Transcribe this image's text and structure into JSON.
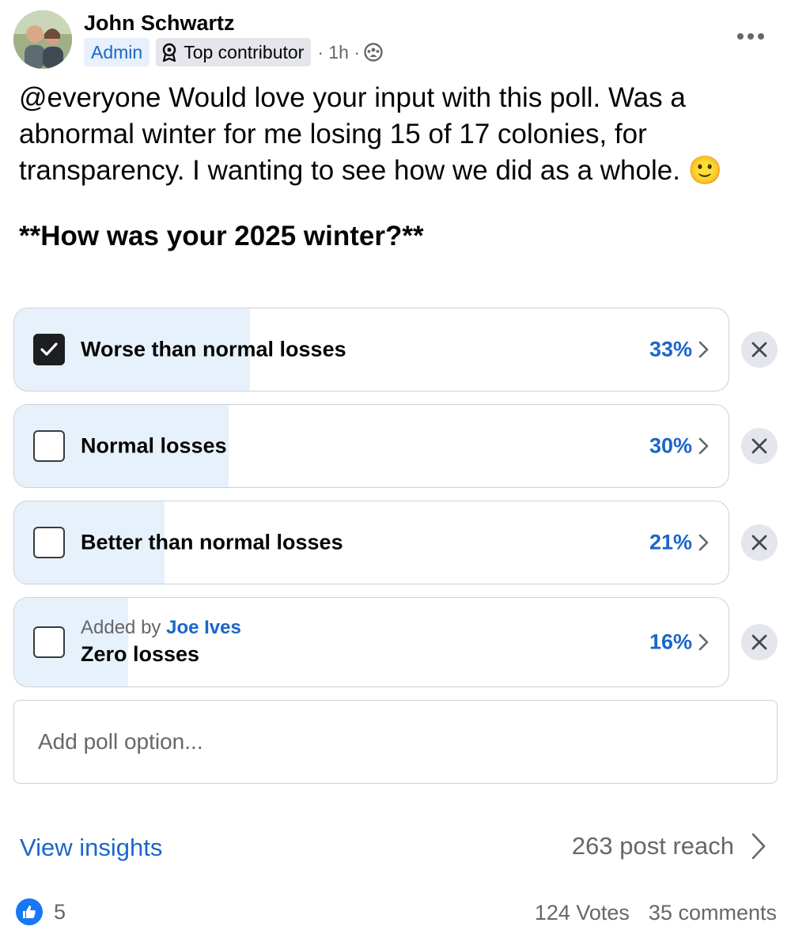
{
  "post": {
    "author": "John Schwartz",
    "badges": {
      "admin": "Admin",
      "top_contributor": "Top contributor"
    },
    "time": "· 1h ·",
    "text": "@everyone Would love your input with this poll. Was a abnormal winter for me losing 15 of 17 colonies, for transparency. I wanting to see how we did as a whole. 🙂",
    "question": "**How was your 2025 winter?**"
  },
  "poll": {
    "options": [
      {
        "label": "Worse than normal losses",
        "percent": "33%",
        "fill": 0.33,
        "checked": true
      },
      {
        "label": "Normal losses",
        "percent": "30%",
        "fill": 0.3,
        "checked": false
      },
      {
        "label": "Better than normal losses",
        "percent": "21%",
        "fill": 0.21,
        "checked": false
      },
      {
        "label": "Zero losses",
        "percent": "16%",
        "fill": 0.16,
        "checked": false,
        "added_by_prefix": "Added by",
        "added_by_name": "Joe Ives"
      }
    ],
    "add_placeholder": "Add poll option..."
  },
  "insights": {
    "link": "View insights",
    "reach": "263 post reach"
  },
  "footer": {
    "likes": "5",
    "votes": "124 Votes",
    "comments": "35 comments"
  },
  "colors": {
    "accent": "#1b66c9",
    "fill": "#e7f1fc",
    "like": "#1877f2"
  }
}
